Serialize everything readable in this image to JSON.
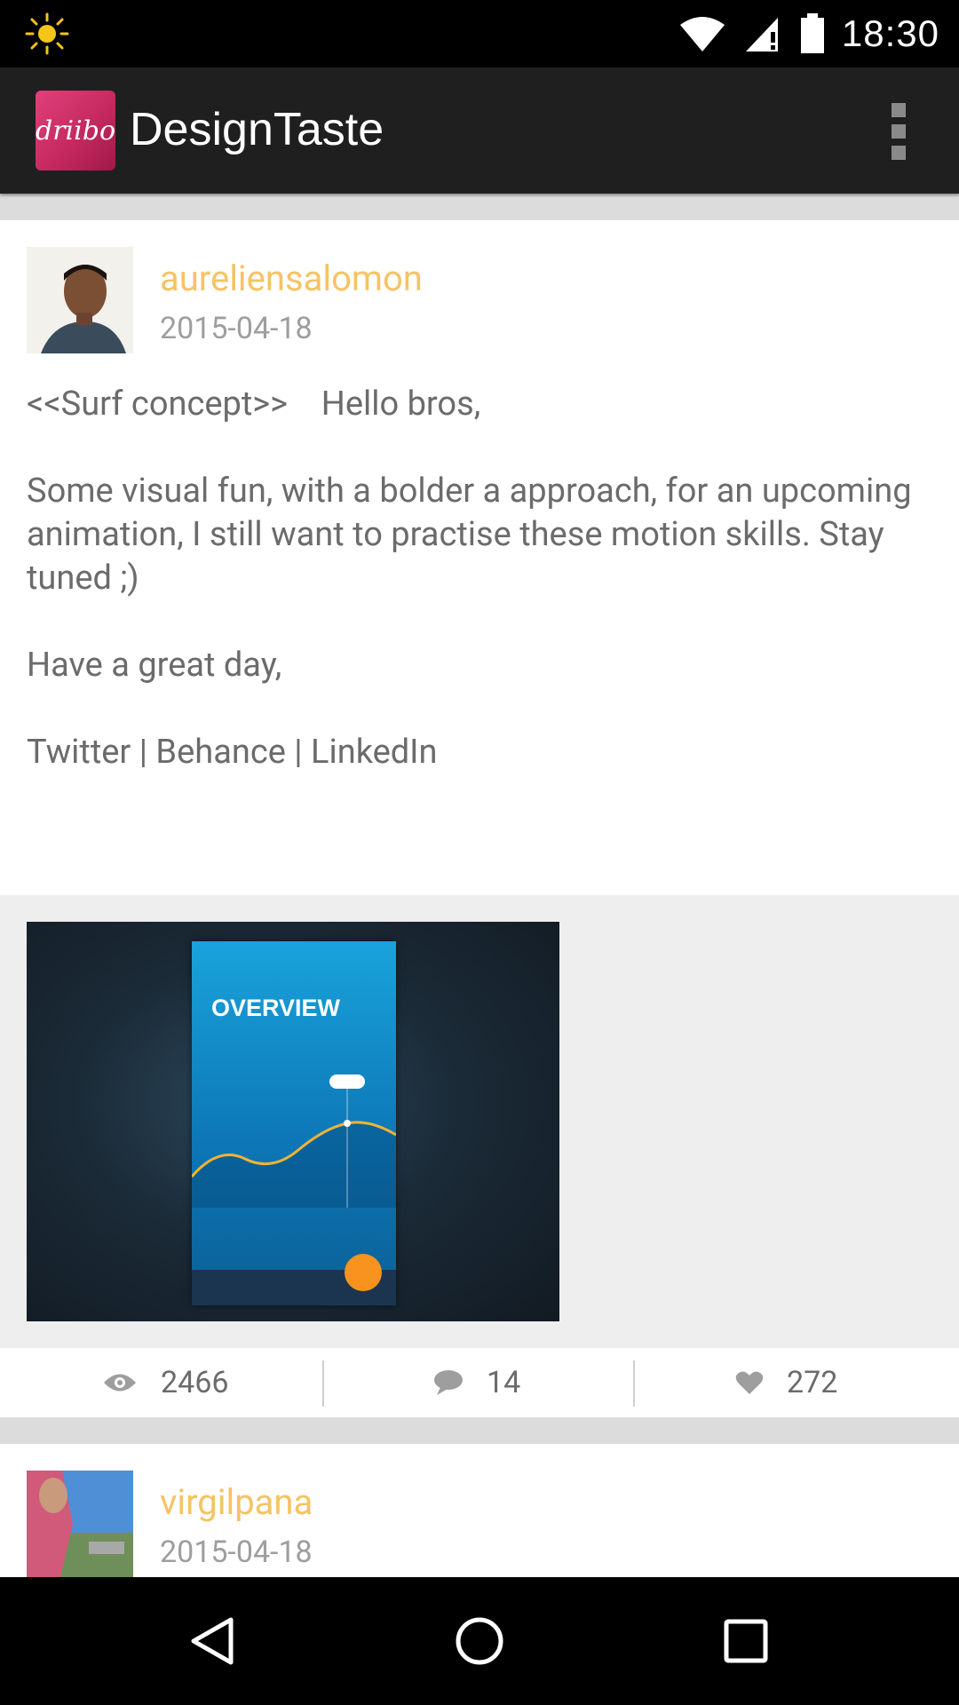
{
  "status_bar": {
    "time": "18:30",
    "icons": [
      "brightness-icon",
      "wifi-icon",
      "signal-icon",
      "battery-icon"
    ]
  },
  "toolbar": {
    "logo_text": "driibo",
    "title": "DesignTaste",
    "menu_icon": "overflow-menu-icon"
  },
  "posts": [
    {
      "author": "aureliensalomon",
      "date": "2015-04-18",
      "text": "<<Surf concept>>    Hello bros,\n\nSome visual fun, with a bolder a approach, for an upcoming animation, I still want to practise these motion skills. Stay tuned ;)\n\nHave a great day,\n\nTwitter | Behance | LinkedIn",
      "shot_title": "OVERVIEW",
      "views": "2466",
      "comments": "14",
      "likes": "272"
    },
    {
      "author": "virgilpana",
      "date": "2015-04-18"
    }
  ],
  "colors": {
    "author": "#f6c364",
    "text": "#6b6b6b",
    "toolbar": "#1f1f1f",
    "logo": "#d6336c"
  },
  "nav": [
    "back-icon",
    "home-icon",
    "recents-icon"
  ]
}
